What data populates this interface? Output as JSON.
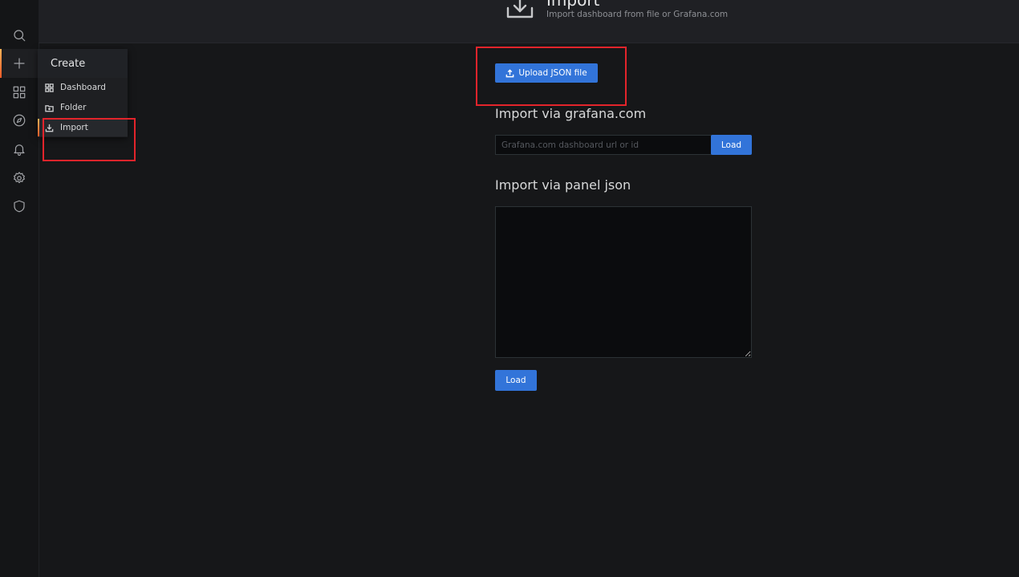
{
  "header": {
    "title": "Import",
    "subtitle": "Import dashboard from file or Grafana.com"
  },
  "sidemenu": {
    "icons": [
      "search-icon",
      "plus-icon",
      "apps-icon",
      "compass-icon",
      "bell-icon",
      "gear-icon",
      "shield-icon"
    ]
  },
  "create_menu": {
    "title": "Create",
    "items": [
      {
        "label": "Dashboard",
        "icon": "apps-icon"
      },
      {
        "label": "Folder",
        "icon": "folder-plus-icon"
      },
      {
        "label": "Import",
        "icon": "import-icon"
      }
    ]
  },
  "upload": {
    "label": "Upload JSON file",
    "icon": "upload-icon"
  },
  "grafana_com": {
    "title": "Import via grafana.com",
    "placeholder": "Grafana.com dashboard url or id",
    "value": "",
    "load_label": "Load"
  },
  "panel_json": {
    "title": "Import via panel json",
    "value": "",
    "load_label": "Load"
  },
  "colors": {
    "accent": "#3274d9",
    "active_indicator": "#f05a28",
    "annotation": "#e3242b"
  }
}
